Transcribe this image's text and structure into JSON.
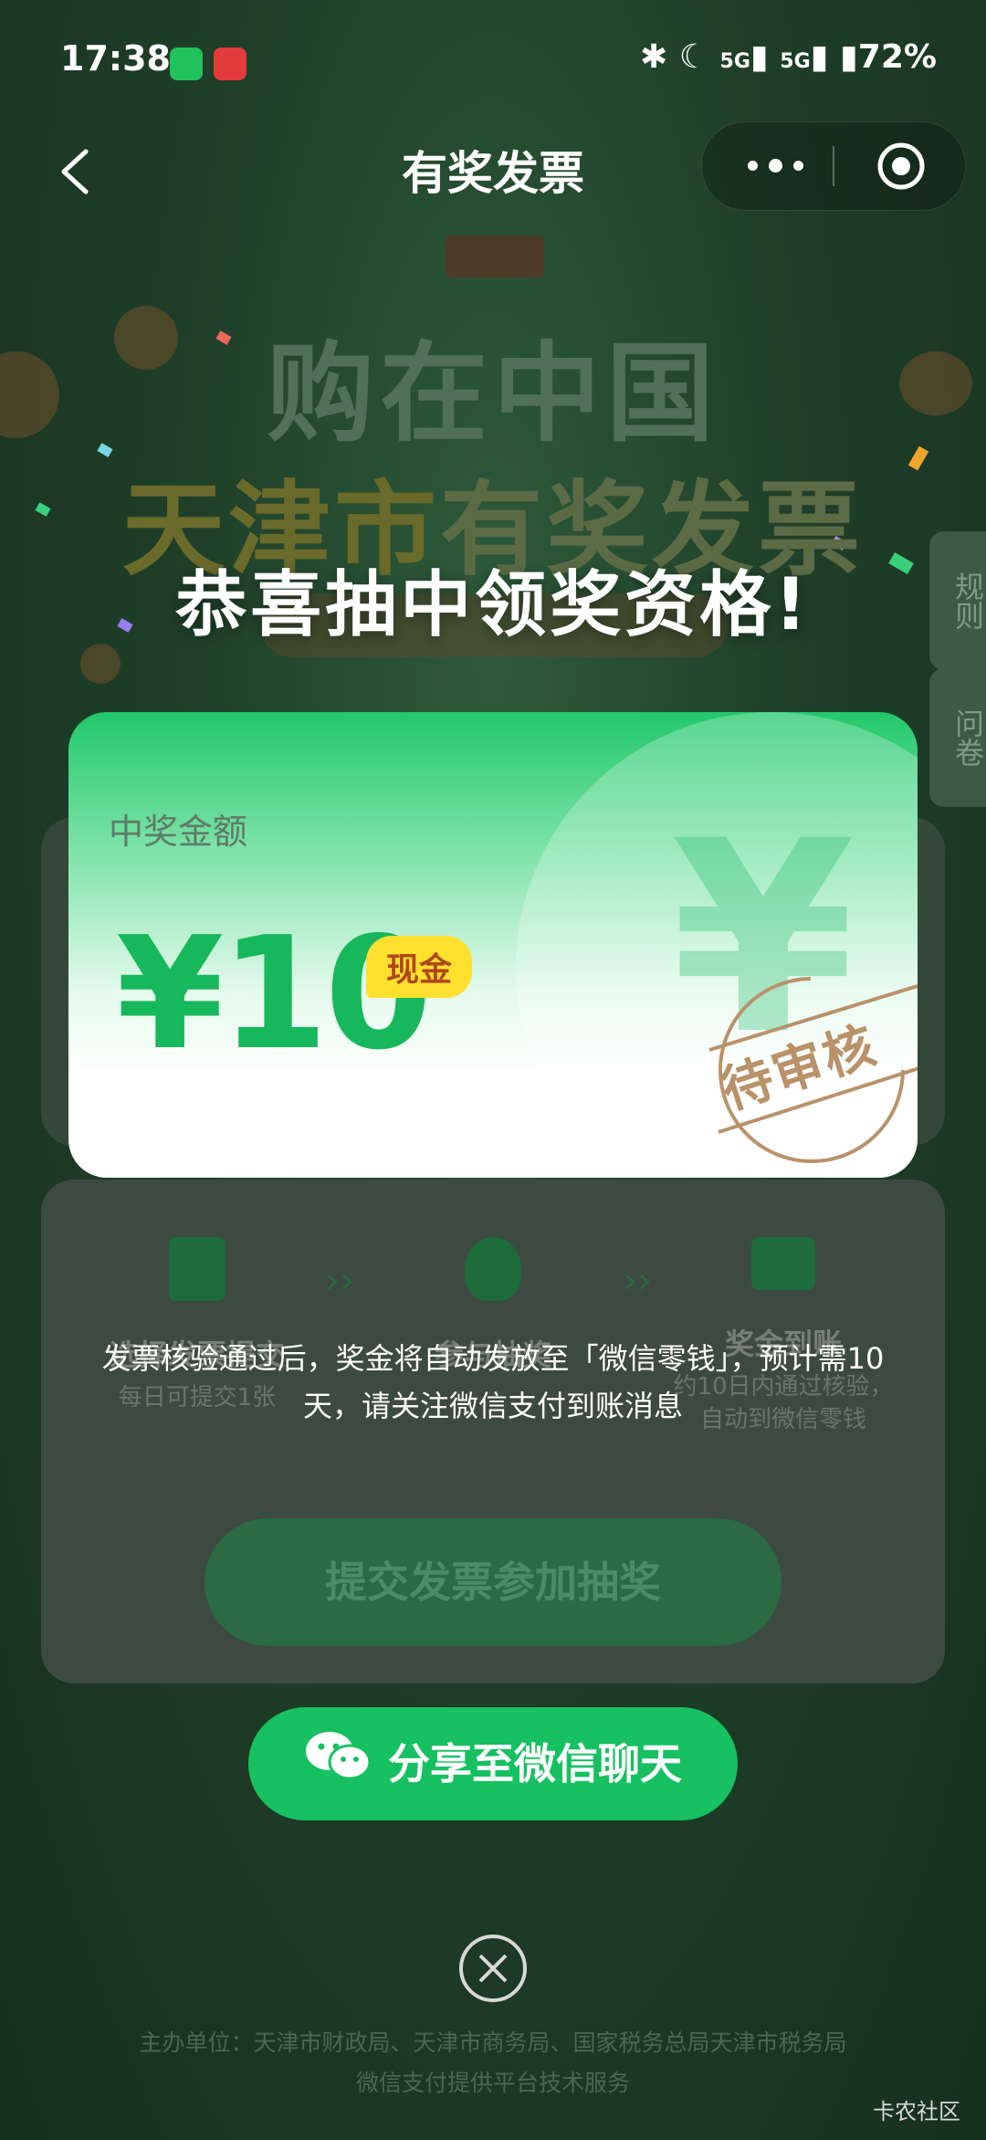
{
  "status_bar": {
    "time": "17:38",
    "signal1": "5G",
    "signal2": "5G",
    "battery": "72%"
  },
  "nav": {
    "title": "有奖发票"
  },
  "background": {
    "headline": "购在中国",
    "city": "天津市",
    "city_rest": "有奖发票",
    "side_tab_rules": "规则",
    "side_tab_survey": "问卷",
    "steps": [
      {
        "title": "选择发票提交",
        "desc": "每日可提交1张"
      },
      {
        "title": "参与抽奖",
        "desc": ""
      },
      {
        "title": "奖金到账",
        "desc": "约10日内通过核验，自动到微信零钱"
      }
    ],
    "submit_button": "提交发票参加抽奖",
    "footer_line1": "主办单位：天津市财政局、天津市商务局、国家税务总局天津市税务局",
    "footer_line2": "微信支付提供平台技术服务"
  },
  "modal": {
    "title": "恭喜抽中领奖资格!",
    "amount_label": "中奖金额",
    "amount": "¥10",
    "badge": "现金",
    "stamp": "待审核",
    "notice": "发票核验通过后，奖金将自动发放至「微信零钱」，预计需10天，请关注微信支付到账消息",
    "share_button": "分享至微信聊天"
  },
  "watermark": "卡农社区",
  "colors": {
    "brand_green": "#17c061",
    "amount_green": "#17b85b",
    "badge_yellow": "#ffe02e"
  }
}
